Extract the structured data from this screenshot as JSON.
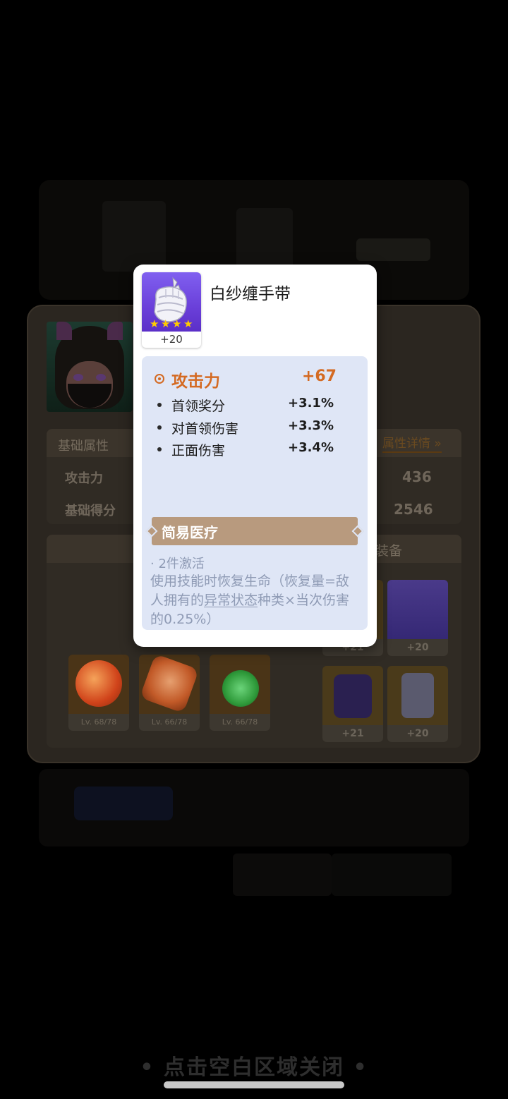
{
  "background": {
    "attributes_header": "基础属性",
    "attributes_link": "属性详情 »",
    "attributes": [
      {
        "label": "攻击力",
        "value": "436"
      },
      {
        "label": "基础得分",
        "value": "2546"
      }
    ],
    "equipment_header": "装备",
    "relics": [
      {
        "level": "Lv. 68/78",
        "color": "#d0431a"
      },
      {
        "level": "Lv. 66/78",
        "color": "#c25a28"
      },
      {
        "level": "Lv. 66/78",
        "color": "#2f9a3a"
      }
    ],
    "gear": [
      {
        "level": "+21",
        "color": "#6a4d20"
      },
      {
        "level": "+20",
        "color": "#4a3a8a"
      },
      {
        "level": "+21",
        "color": "#6a4d20"
      },
      {
        "level": "+20",
        "color": "#6a4d20"
      }
    ],
    "close_hint": "• 点击空白区域关闭 •"
  },
  "popup": {
    "item": {
      "name": "白纱缠手带",
      "level": "+20",
      "stars": 4,
      "icon": "wrapped-glove-icon",
      "rarity_color": "#6a3fd9"
    },
    "main_stat": {
      "label": "攻击力",
      "value": "+67",
      "color": "#d46a22"
    },
    "sub_stats": [
      {
        "label": "首领奖分",
        "value": "+3.1%"
      },
      {
        "label": "对首领伤害",
        "value": "+3.3%"
      },
      {
        "label": "正面伤害",
        "value": "+3.4%"
      }
    ],
    "set": {
      "name": "简易医疗",
      "tier": "· 2件激活",
      "desc_before": "使用技能时恢复生命（恢复量=敌人拥有的",
      "desc_keyword": "异常状态",
      "desc_after": "种类×当次伤害的0.25%）"
    }
  }
}
